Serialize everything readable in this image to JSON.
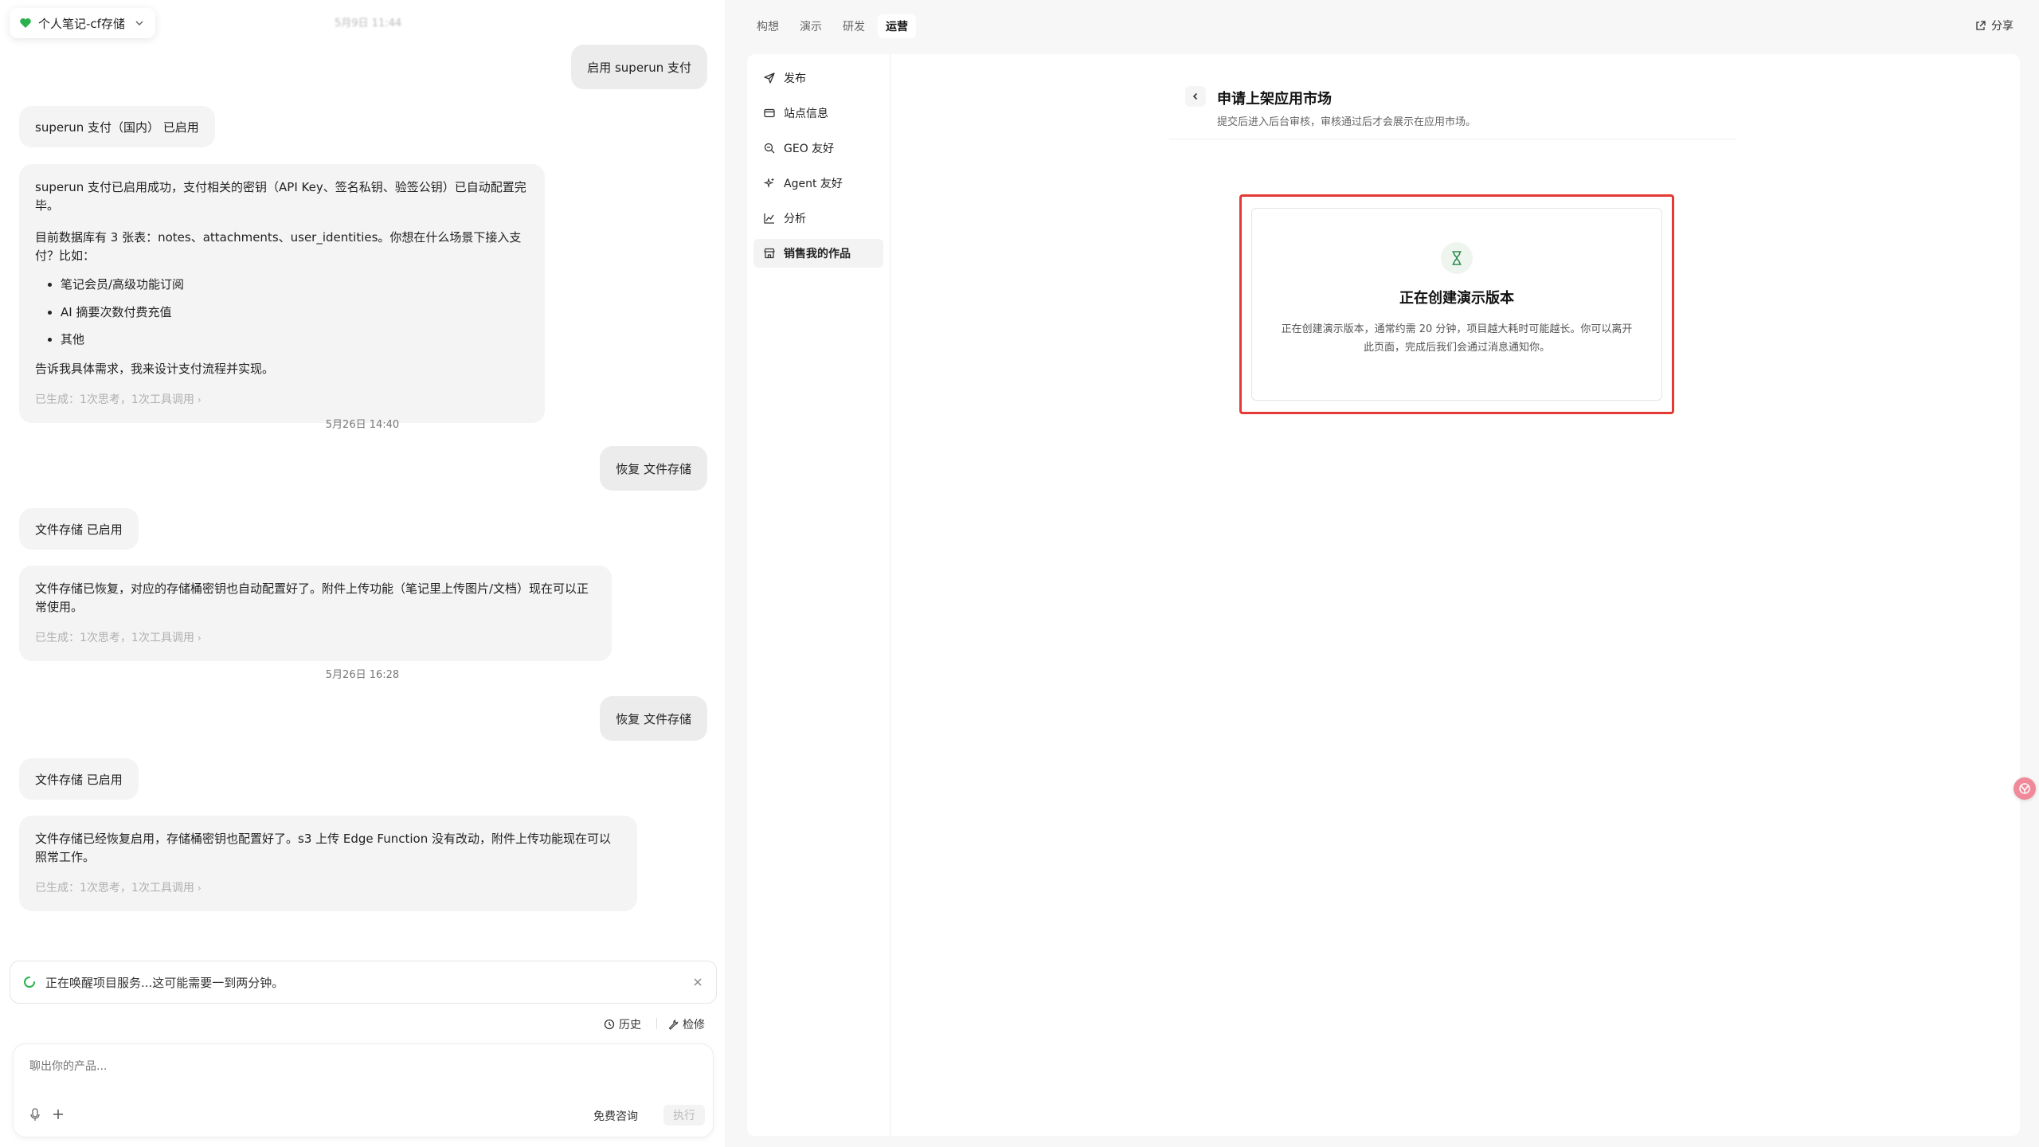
{
  "header": {
    "project_name": "个人笔记-cf存储",
    "top_timestamp": "5月9日 11:44"
  },
  "chat": {
    "messages": {
      "m1_user": "启用 superun 支付",
      "m2_system": "superun 支付（国内） 已启用",
      "m3_ai": {
        "p1": "superun 支付已启用成功，支付相关的密钥（API Key、签名私钥、验签公钥）已自动配置完毕。",
        "p2": "目前数据库有 3 张表：notes、attachments、user_identities。你想在什么场景下接入支付？比如：",
        "bullets": [
          "笔记会员/高级功能订阅",
          "AI 摘要次数付费充值",
          "其他"
        ],
        "p3": "告诉我具体需求，我来设计支付流程并实现。",
        "meta": "已生成：1次思考，1次工具调用"
      },
      "divider1": "5月26日 14:40",
      "m4_user": "恢复 文件存储",
      "m5_system": "文件存储 已启用",
      "m6_ai": {
        "p1": "文件存储已恢复，对应的存储桶密钥也自动配置好了。附件上传功能（笔记里上传图片/文档）现在可以正常使用。",
        "meta": "已生成：1次思考，1次工具调用"
      },
      "divider2": "5月26日 16:28",
      "m7_user": "恢复 文件存储",
      "m8_system": "文件存储 已启用",
      "m9_ai": {
        "p1": "文件存储已经恢复启用，存储桶密钥也配置好了。s3 上传 Edge Function 没有改动，附件上传功能现在可以照常工作。",
        "meta": "已生成：1次思考，1次工具调用"
      }
    },
    "status_notice": "正在唤醒项目服务...这可能需要一到两分钟。",
    "toolbar": {
      "history": "历史",
      "repair": "检修"
    },
    "composer": {
      "placeholder": "聊出你的产品...",
      "free_consult": "免费咨询",
      "execute": "执行"
    }
  },
  "top_tabs": [
    {
      "label": "构想",
      "active": false
    },
    {
      "label": "演示",
      "active": false
    },
    {
      "label": "研发",
      "active": false
    },
    {
      "label": "运营",
      "active": true
    }
  ],
  "share_label": "分享",
  "side_nav": [
    {
      "label": "发布",
      "icon": "send-icon",
      "active": false
    },
    {
      "label": "站点信息",
      "icon": "card-icon",
      "active": false
    },
    {
      "label": "GEO 友好",
      "icon": "search-zoom-icon",
      "active": false
    },
    {
      "label": "Agent 友好",
      "icon": "sparkle-icon",
      "active": false
    },
    {
      "label": "分析",
      "icon": "chart-icon",
      "active": false
    },
    {
      "label": "销售我的作品",
      "icon": "store-icon",
      "active": true
    }
  ],
  "panel": {
    "title": "申请上架应用市场",
    "subtitle": "提交后进入后台审核，审核通过后才会展示在应用市场。",
    "status_title": "正在创建演示版本",
    "status_desc": "正在创建演示版本，通常约需 20 分钟，项目越大耗时可能越长。你可以离开此页面，完成后我们会通过消息通知你。"
  },
  "colors": {
    "accent_green": "#2bb24c",
    "highlight_red": "#e53935",
    "badge_pink": "#f08a9a"
  }
}
